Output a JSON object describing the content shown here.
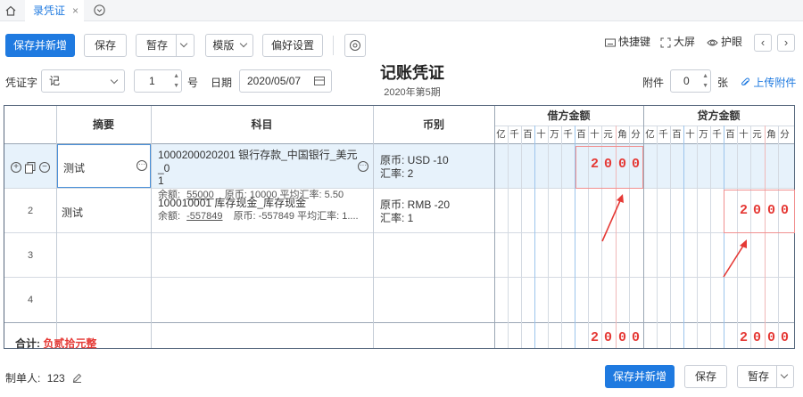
{
  "tabs": {
    "active_label": "录凭证",
    "close": "×"
  },
  "toolbar": {
    "save_new": "保存并新增",
    "save": "保存",
    "draft": "暂存",
    "template": "模版",
    "preferences": "偏好设置",
    "shortcut": "快捷键",
    "fullscreen": "大屏",
    "eye_care": "护眼"
  },
  "voucher": {
    "word_label": "凭证字",
    "word_value": "记",
    "number": "1",
    "number_unit": "号",
    "date_label": "日期",
    "date_value": "2020/05/07",
    "title": "记账凭证",
    "period": "2020年第5期",
    "attach_label": "附件",
    "attach_value": "0",
    "attach_unit": "张",
    "upload": "上传附件"
  },
  "table": {
    "headers": {
      "summary": "摘要",
      "subject": "科目",
      "currency": "币别",
      "debit": "借方金额",
      "credit": "贷方金额"
    },
    "digits": [
      "亿",
      "千",
      "百",
      "十",
      "万",
      "千",
      "百",
      "十",
      "元",
      "角",
      "分"
    ],
    "rows": [
      {
        "summary": "测试",
        "subject": "1000200020201   银行存款_中国银行_美元_0",
        "subject_wrap": "1",
        "balance_label": "余额:",
        "balance": "55000",
        "orig_info": "原币: 10000 平均汇率: 5.50",
        "currency": "原币:  USD -10",
        "rate": "汇率:  2",
        "debit": [
          "2",
          "0",
          "0",
          "0"
        ],
        "credit": []
      },
      {
        "num": "2",
        "summary": "测试",
        "subject": "100010001   库存现金_库存现金",
        "balance_label": "余额:",
        "balance": "-557849",
        "orig_info": "原币: -557849 平均汇率: 1....",
        "currency": "原币:  RMB -20",
        "rate": "汇率:  1",
        "debit": [],
        "credit": [
          "2",
          "0",
          "0",
          "0"
        ]
      },
      {
        "num": "3"
      },
      {
        "num": "4"
      }
    ],
    "total_label": "合计:",
    "total_words": "负贰拾元整",
    "total_debit": [
      "2",
      "0",
      "0",
      "0"
    ],
    "total_credit": [
      "2",
      "0",
      "0",
      "0"
    ]
  },
  "footer": {
    "maker_label": "制单人:",
    "maker": "123",
    "save_new": "保存并新增",
    "save": "保存",
    "draft": "暂存"
  }
}
